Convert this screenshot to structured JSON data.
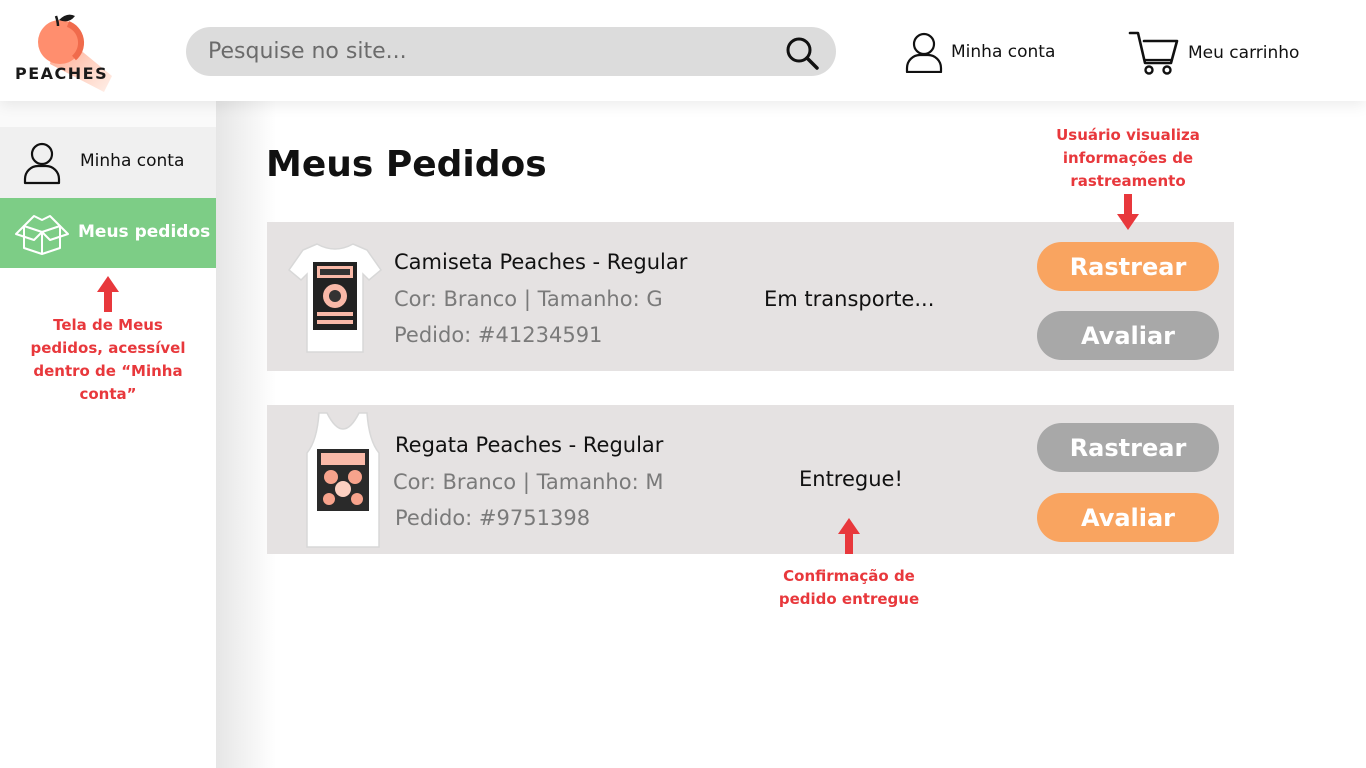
{
  "brand": {
    "name": "PEACHES"
  },
  "search": {
    "placeholder": "Pesquise no site..."
  },
  "header": {
    "account_label": "Minha conta",
    "cart_label": "Meu carrinho"
  },
  "sidebar": {
    "items": [
      {
        "label": "Minha conta"
      },
      {
        "label": "Meus pedidos"
      }
    ]
  },
  "main": {
    "title": "Meus Pedidos",
    "orders": [
      {
        "name": "Camiseta Peaches - Regular",
        "details": "Cor: Branco | Tamanho: G",
        "order_id": "Pedido: #41234591",
        "status": "Em transporte...",
        "track_label": "Rastrear",
        "review_label": "Avaliar"
      },
      {
        "name": "Regata Peaches - Regular",
        "details": "Cor: Branco | Tamanho: M",
        "order_id": "Pedido: #9751398",
        "status": "Entregue!",
        "track_label": "Rastrear",
        "review_label": "Avaliar"
      }
    ]
  },
  "annotations": {
    "tracking": "Usuário visualiza informações de rastreamento",
    "sidebar_note": "Tela de Meus pedidos, acessível dentro de “Minha conta”",
    "delivered_note": "Confirmação de pedido entregue"
  },
  "colors": {
    "accent_orange": "#f9a460",
    "sidebar_active": "#7dcd86",
    "button_gray": "#a8a8a8",
    "annotation_red": "#e8383c",
    "card_bg": "#e5e2e2"
  }
}
